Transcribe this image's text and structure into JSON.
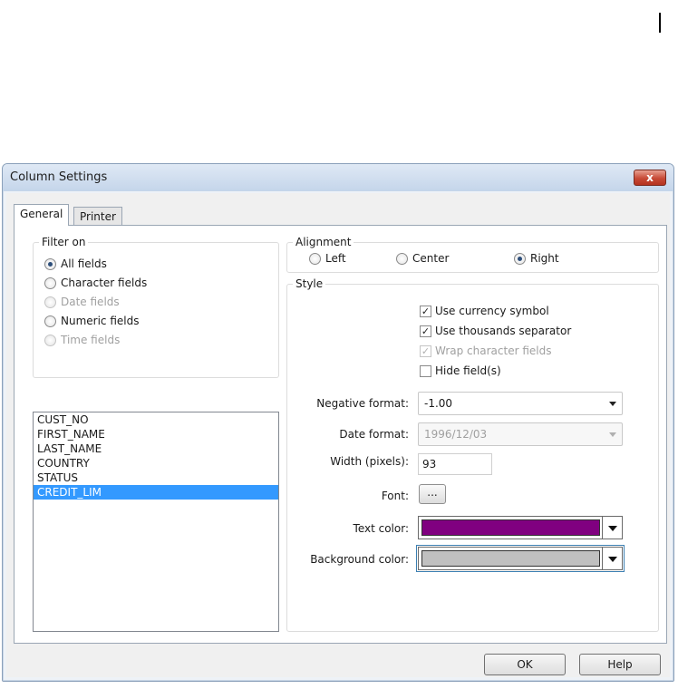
{
  "window": {
    "title": "Column Settings",
    "close_label": "x"
  },
  "tabs": [
    {
      "label": "General",
      "active": true
    },
    {
      "label": "Printer",
      "active": false
    }
  ],
  "filter": {
    "label": "Filter on",
    "options": [
      {
        "label": "All fields",
        "checked": true,
        "enabled": true
      },
      {
        "label": "Character fields",
        "checked": false,
        "enabled": true
      },
      {
        "label": "Date fields",
        "checked": false,
        "enabled": false
      },
      {
        "label": "Numeric fields",
        "checked": false,
        "enabled": true
      },
      {
        "label": "Time fields",
        "checked": false,
        "enabled": false
      }
    ]
  },
  "fields_list": [
    {
      "name": "CUST_NO",
      "selected": false
    },
    {
      "name": "FIRST_NAME",
      "selected": false
    },
    {
      "name": "LAST_NAME",
      "selected": false
    },
    {
      "name": "COUNTRY",
      "selected": false
    },
    {
      "name": "STATUS",
      "selected": false
    },
    {
      "name": "CREDIT_LIM",
      "selected": true
    }
  ],
  "alignment": {
    "label": "Alignment",
    "options": [
      {
        "label": "Left",
        "checked": false
      },
      {
        "label": "Center",
        "checked": false
      },
      {
        "label": "Right",
        "checked": true
      }
    ]
  },
  "style": {
    "label": "Style",
    "checks": [
      {
        "label": "Use currency symbol",
        "checked": true,
        "enabled": true
      },
      {
        "label": "Use thousands separator",
        "checked": true,
        "enabled": true
      },
      {
        "label": "Wrap character fields",
        "checked": true,
        "enabled": false
      },
      {
        "label": "Hide field(s)",
        "checked": false,
        "enabled": true
      }
    ],
    "negative_format": {
      "label": "Negative format:",
      "value": "-1.00"
    },
    "date_format": {
      "label": "Date format:",
      "value": "1996/12/03"
    },
    "width": {
      "label": "Width (pixels):",
      "value": "93"
    },
    "font": {
      "label": "Font:",
      "button": "..."
    },
    "text_color": {
      "label": "Text color:",
      "color": "#800080"
    },
    "background_color": {
      "label": "Background color:",
      "color": "#c0c0c0"
    }
  },
  "buttons": {
    "ok": "OK",
    "help": "Help"
  }
}
